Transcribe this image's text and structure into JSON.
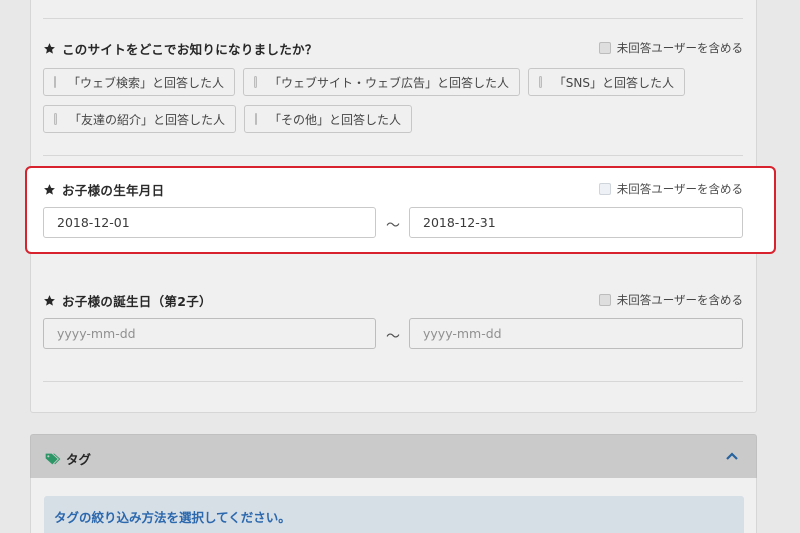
{
  "questions": {
    "source": {
      "title": "このサイトをどこでお知りになりましたか？",
      "unanswered_label": "未回答ユーザーを含める",
      "options": [
        "「ウェブ検索」と回答した人",
        "「ウェブサイト・ウェブ広告」と回答した人",
        "「SNS」と回答した人",
        "「友達の紹介」と回答した人",
        "「その他」と回答した人"
      ]
    },
    "child_birth": {
      "title": "お子様の生年月日",
      "unanswered_label": "未回答ユーザーを含める",
      "from_value": "2018-12-01",
      "to_value": "2018-12-31",
      "separator": "〜"
    },
    "child2_birthday": {
      "title": "お子様の誕生日（第2子）",
      "unanswered_label": "未回答ユーザーを含める",
      "from_placeholder": "yyyy-mm-dd",
      "to_placeholder": "yyyy-mm-dd",
      "separator": "〜"
    }
  },
  "tag_section": {
    "title": "タグ",
    "icon": "tag-icon",
    "collapse_icon": "chevron-up-icon",
    "instruction": "タグの絞り込み方法を選択してください。"
  },
  "colors": {
    "highlight_border": "#d8232f",
    "tag_icon": "#2fa06d",
    "info_text": "#2e6fb8",
    "info_bg": "#e4ecf5"
  }
}
